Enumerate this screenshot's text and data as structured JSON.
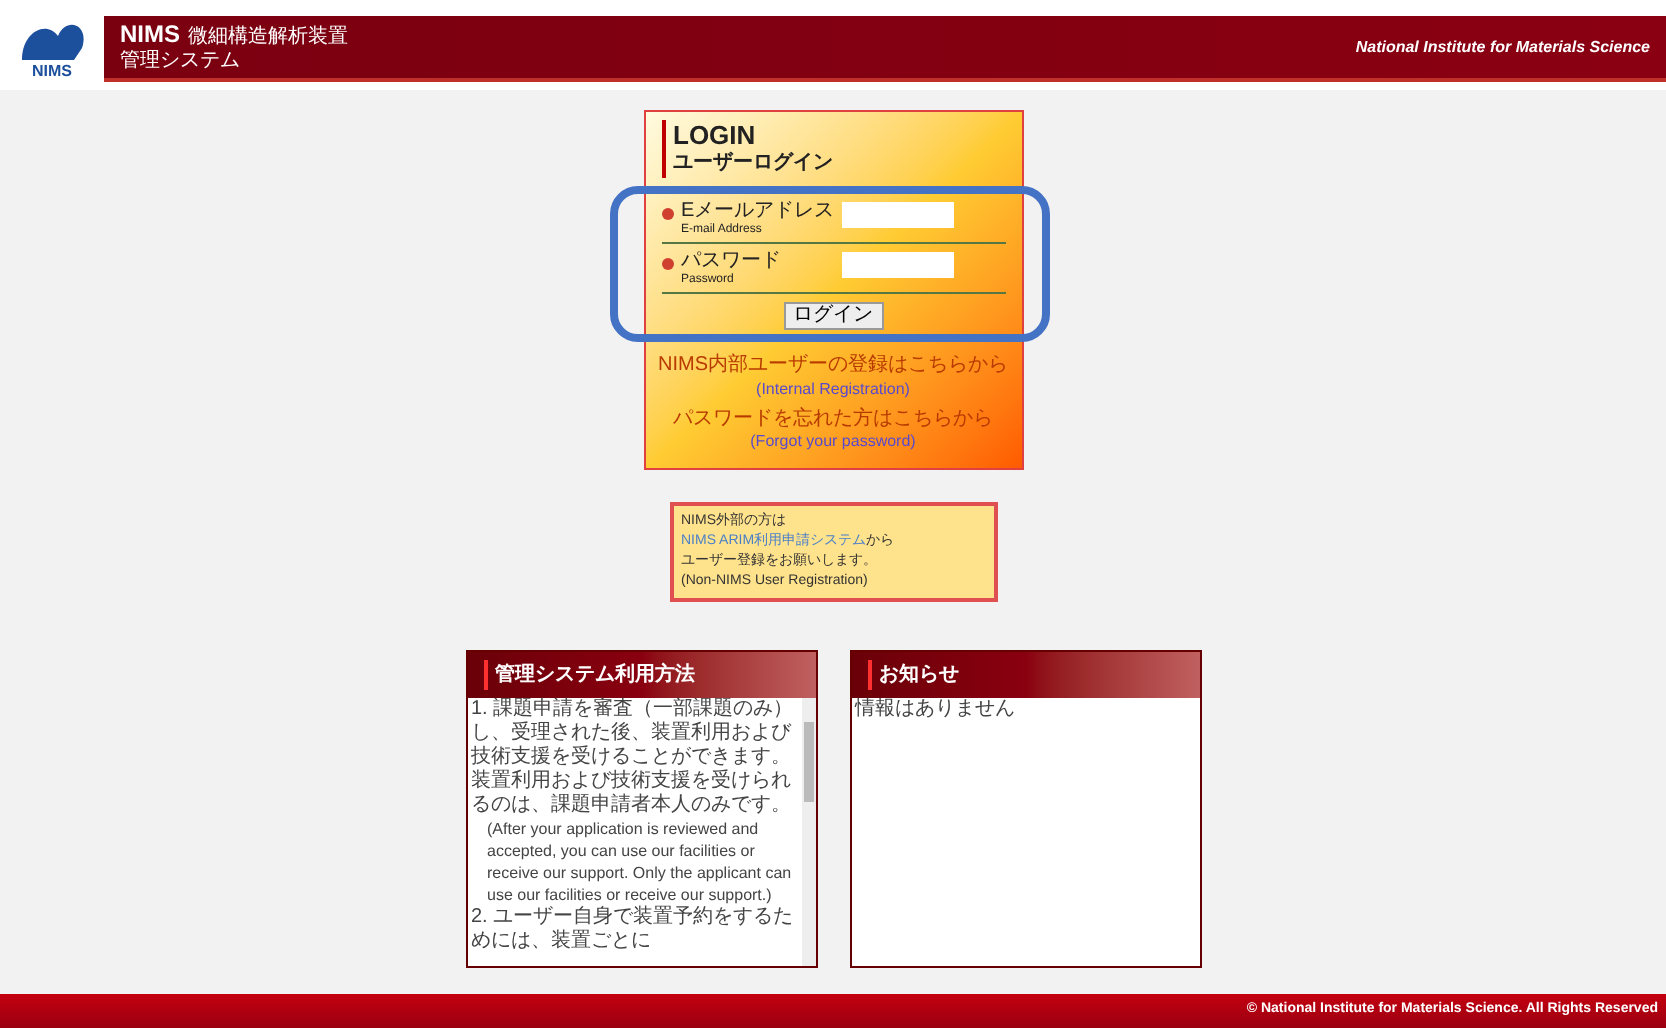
{
  "header": {
    "logo_text": "NIMS",
    "title": "NIMS",
    "title_sub": "微細構造解析装置",
    "subtitle": "管理システム",
    "org": "National Institute for Materials Science"
  },
  "login": {
    "title": "LOGIN",
    "subtitle": "ユーザーログイン",
    "fields": [
      {
        "label": "Eメールアドレス",
        "label_en": "E-mail Address"
      },
      {
        "label": "パスワード",
        "label_en": "Password"
      }
    ],
    "button": "ログイン",
    "links": [
      {
        "text": "NIMS内部ユーザーの登録はこちらから",
        "link": "(Internal Registration)"
      },
      {
        "text": "パスワードを忘れた方はこちらから",
        "link": "(Forgot your password)"
      }
    ]
  },
  "notice": {
    "lines": [
      {
        "text": "NIMS外部の方は",
        "kind": "text"
      },
      {
        "text": "NIMS ARIM利用申請システム",
        "suffix": "から",
        "kind": "link"
      },
      {
        "text": "ユーザー登録をお願いします。",
        "kind": "text"
      },
      {
        "text": "(Non-NIMS User Registration)",
        "kind": "text"
      }
    ]
  },
  "panels": [
    {
      "title": "管理システム利用方法",
      "items": [
        {
          "text": "1. 課題申請を審査（一部課題のみ）し、受理された後、装置利用および技術支援を受けることができます。装置利用および技術支援を受けられるのは、課題申請者本人のみです。",
          "en": "(After your application is reviewed and accepted, you can use our facilities or receive our support. Only the applicant can use our facilities or receive our support.)"
        },
        {
          "text": "2. ユーザー自身で装置予約をするためには、装置ごとに"
        }
      ],
      "scrollbar": true
    },
    {
      "title": "お知らせ",
      "items": [
        {
          "text": "情報はありません"
        }
      ],
      "scrollbar": false
    }
  ],
  "footer": "© National Institute for Materials Science. All Rights Reserved",
  "annotation": {
    "kind": "highlight"
  }
}
